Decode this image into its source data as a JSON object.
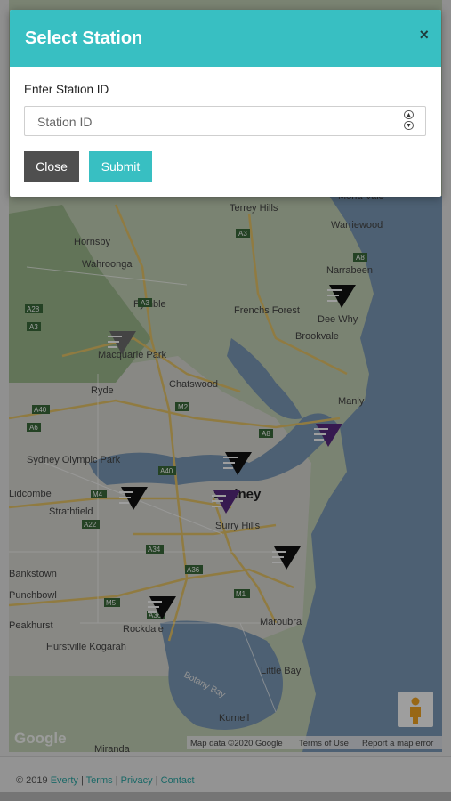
{
  "modal": {
    "title": "Select Station",
    "close_glyph": "×",
    "field_label": "Enter Station ID",
    "input_placeholder": "Station ID",
    "input_value": "",
    "close_button": "Close",
    "submit_button": "Submit",
    "header_color": "#38bfc2"
  },
  "map": {
    "place_labels": {
      "mona_vale": "Mona Vale",
      "terrey_hills": "Terrey Hills",
      "warriewood": "Warriewood",
      "hornsby": "Hornsby",
      "wahroonga": "Wahroonga",
      "narrabeen": "Narrabeen",
      "pymble": "Pymble",
      "frenchs_forest": "Frenchs Forest",
      "dee_why": "Dee Why",
      "brookvale": "Brookvale",
      "macquarie_park": "Macquarie Park",
      "chatswood": "Chatswood",
      "manly": "Manly",
      "ryde": "Ryde",
      "sydney_olympic_park": "Sydney Olympic Park",
      "sydney": "Sydney",
      "strathfield": "Strathfield",
      "surry_hills": "Surry Hills",
      "lidcombe": "Lidcombe",
      "bankstown": "Bankstown",
      "punchbowl": "Punchbowl",
      "peakhurst": "Peakhurst",
      "rockdale": "Rockdale",
      "maroubra": "Maroubra",
      "hurstville_kogarah": "Hurstville Kogarah",
      "botany_bay": "Botany Bay",
      "little_bay": "Little Bay",
      "kurnell": "Kurnell",
      "miranda": "Miranda"
    },
    "road_labels": [
      "A3",
      "A28",
      "A3",
      "A3",
      "M2",
      "A40",
      "A6",
      "A8",
      "A40",
      "M4",
      "A22",
      "A34",
      "A36",
      "M5",
      "A36",
      "M1",
      "A8"
    ],
    "google_logo": "Google",
    "attribution": "Map data ©2020 Google",
    "terms_of_use": "Terms of Use",
    "report_error": "Report a map error",
    "pegman_icon": "pegman-icon",
    "station_marker_icon": "station-marker-icon",
    "marker_colors": {
      "normal": "#111111",
      "purple": "#5a2a82",
      "grey": "#6e6e6e"
    }
  },
  "footer": {
    "copyright": "© 2019",
    "links": [
      "Everty",
      "Terms",
      "Privacy",
      "Contact"
    ],
    "separator": "|",
    "link_color": "#2ba9a6"
  }
}
